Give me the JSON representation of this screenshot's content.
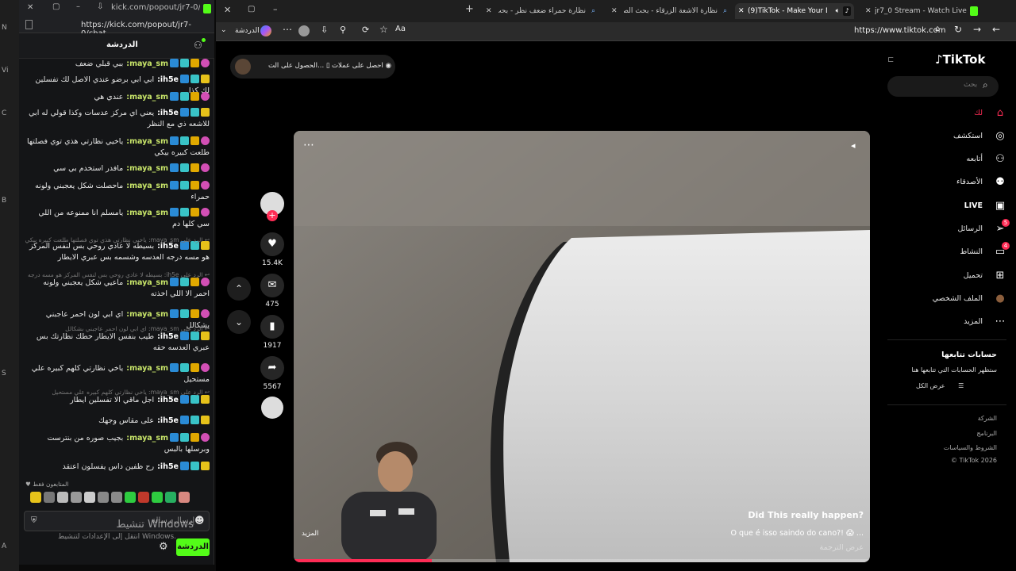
{
  "left_strip": [
    "N",
    "Vi",
    "C",
    "B",
    "S",
    "A"
  ],
  "kick": {
    "title_url": "kick.com/popout/jr7-0/ch...",
    "full_url": "https://kick.com/popout/jr7-0/chat",
    "header_title": "الدردشة",
    "messages": [
      {
        "user": "maya_sm",
        "text": "ببي قبلي ضعف",
        "cls": "u1"
      },
      {
        "user": "ih5e",
        "text": "ابي ابي برضو عندي الاصل لك تفسلين لك كذا",
        "cls": "u2"
      },
      {
        "user": "maya_sm",
        "text": "عندي هي",
        "cls": "u1"
      },
      {
        "user": "ih5e",
        "text": "يعني اي مركز عدسات وكذا قولي له ابي للاشعه ذي مع النظر",
        "cls": "u2"
      },
      {
        "user": "maya_sm",
        "text": "ياخيي نظارتي هذي توي فصلتها طلعت كبيره بيكي",
        "cls": "u1"
      },
      {
        "user": "maya_sm",
        "text": "مافدر استخدم بي سي",
        "cls": "u1"
      },
      {
        "user": "maya_sm",
        "text": "ماحصلت شكل يعجبني ولونه حمراء",
        "cls": "u1"
      },
      {
        "user": "maya_sm",
        "text": "يامسلم انا ممنوعه من اللي سي كلها دم",
        "cls": "u1"
      },
      {
        "user": "ih5e",
        "text": "بسيطه لا عادي روحي بس لنفس المركز هو مسه درجه العدسه وشسمه بس عبري الايطار",
        "cls": "u2"
      },
      {
        "user": "maya_sm",
        "text": "ماعيي شكل يعجبني ولونه احمر الا اللي اخذته",
        "cls": "u1"
      },
      {
        "user": "maya_sm",
        "text": "اي ابي لون احمر عاجبني بشكالل",
        "cls": "u1"
      },
      {
        "user": "ih5e",
        "text": "طيب بنفس الايطار حطك نظارتك بس عبري العدسه حقه",
        "cls": "u2"
      },
      {
        "user": "maya_sm",
        "text": "ياخي نظارتي كلهم كبيره علي مستحيل",
        "cls": "u1"
      },
      {
        "user": "ih5e",
        "text": "اجل ماقي الا تفسلين ايطار",
        "cls": "u2"
      },
      {
        "user": "ih5e",
        "text": "على مقاس وجهك",
        "cls": "u2"
      },
      {
        "user": "maya_sm",
        "text": "بجيب صوره من بنترست وبرسلها بالبس",
        "cls": "u1"
      },
      {
        "user": "ih5e",
        "text": "رح ظفين داس يفسلون اعتقد",
        "cls": "u2"
      }
    ],
    "replies": [
      "الرد على maya_sm: ياخيي نظارتي هذي توي فصلتها طلعت كبيره بيكي",
      "الرد على ih5e: بسيطه لا عادي روحي بس لنفس المركز هو مسه درجه العدسه وشسمه",
      "الرد على maya_sm: اي ابي لون احمر عاجبني بشكالل",
      "الرد على maya_sm: ياخي نظارتي كلهم كبيره علي مستحيل"
    ],
    "followers_only": "المتابعون فقط",
    "input_placeholder": "إرسال رسالة",
    "send_label": "الدردشة",
    "watermark_title": "تنشيط Windows",
    "watermark_sub": "انتقل إلى الإعدادات لتنشيط Windows."
  },
  "browser": {
    "tabs": [
      {
        "label": "نظارة حمراء ضعف نظر - بحث",
        "active": false
      },
      {
        "label": "نظارة الاشعة الزرقاء - بحث الصور",
        "active": false
      },
      {
        "label": "(9)TikTok - Make Your Day",
        "active": true
      },
      {
        "label": "jr7_0 Stream - Watch Live on Kick",
        "active": false
      }
    ],
    "address": "https://www.tiktok.com",
    "sidebar_toggle_label": "الدردشة"
  },
  "tiktok": {
    "logo": "TikTok",
    "search_placeholder": "بحث",
    "nav": [
      {
        "label": "لك",
        "icon": "home-icon",
        "glyph": "⌂",
        "active": true,
        "badge": ""
      },
      {
        "label": "استكشف",
        "icon": "compass-icon",
        "glyph": "◎",
        "active": false,
        "badge": ""
      },
      {
        "label": "أتابعه",
        "icon": "person-add-icon",
        "glyph": "⚇",
        "active": false,
        "badge": ""
      },
      {
        "label": "الأصدقاء",
        "icon": "friends-icon",
        "glyph": "⚉",
        "active": false,
        "badge": ""
      },
      {
        "label": "LIVE",
        "icon": "live-icon",
        "glyph": "▣",
        "active": false,
        "badge": ""
      },
      {
        "label": "الرسائل",
        "icon": "messages-icon",
        "glyph": "➢",
        "active": false,
        "badge": "5"
      },
      {
        "label": "النشاط",
        "icon": "activity-icon",
        "glyph": "▭",
        "active": false,
        "badge": "4"
      },
      {
        "label": "تحميل",
        "icon": "upload-icon",
        "glyph": "⊞",
        "active": false,
        "badge": ""
      },
      {
        "label": "الملف الشخصي",
        "icon": "profile-avatar-icon",
        "glyph": "●",
        "active": false,
        "badge": ""
      },
      {
        "label": "المزيد",
        "icon": "more-icon",
        "glyph": "⋯",
        "active": false,
        "badge": ""
      }
    ],
    "following_title": "حسابات تتابعها",
    "following_hint": "ستظهر الحسابات التي تتابعها هنا",
    "see_all": "عرض الكل",
    "footer": [
      "الشركة",
      "البرنامج",
      "الشروط والسياسات",
      "© TikTok 2026"
    ],
    "top_buttons": {
      "coins": "احصل على عملات",
      "app": "الحصول على الت..."
    },
    "video": {
      "title": "Did This really happen?",
      "caption": "O que é isso saindo do cano?! 😱 ...",
      "more": "المزيد",
      "translate": "عرض الترجمة",
      "progress": 0.24
    },
    "actions": {
      "likes": "15.4K",
      "comments": "475",
      "saves": "1917",
      "shares": "5567"
    }
  }
}
